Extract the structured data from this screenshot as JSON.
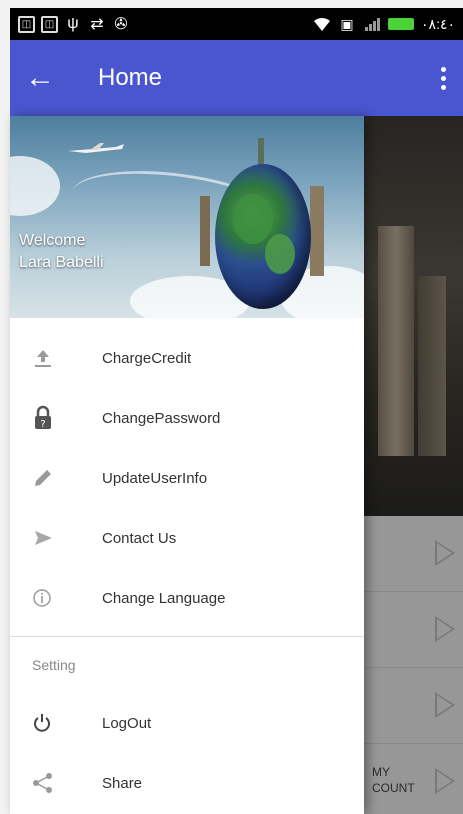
{
  "status_bar": {
    "time": "٠٨:٤٠",
    "icons": [
      "notification-icon",
      "notification-icon",
      "usb-icon",
      "sync-icon",
      "app-icon",
      "wifi-icon",
      "sim-icon",
      "signal-icon",
      "battery-icon"
    ]
  },
  "app_bar": {
    "title": "Home",
    "back_icon": "arrow-left-icon",
    "overflow_icon": "more-vertical-icon"
  },
  "drawer": {
    "header": {
      "welcome": "Welcome",
      "user_name": "Lara Babelli"
    },
    "items": [
      {
        "label": "ChargeCredit",
        "icon": "upload-icon"
      },
      {
        "label": "ChangePassword",
        "icon": "lock-icon"
      },
      {
        "label": "UpdateUserInfo",
        "icon": "pencil-icon"
      },
      {
        "label": "Contact Us",
        "icon": "send-icon"
      },
      {
        "label": "Change Language",
        "icon": "info-icon"
      }
    ],
    "section_label": "Setting",
    "settings_items": [
      {
        "label": "LogOut",
        "icon": "power-icon"
      },
      {
        "label": "Share",
        "icon": "share-icon"
      }
    ]
  },
  "background": {
    "row_label_line1": "MY",
    "row_label_line2": "COUNT"
  },
  "colors": {
    "app_bar": "#4a56cf",
    "drawer_bg": "#ffffff",
    "icon_gray": "#8a8a8a"
  }
}
